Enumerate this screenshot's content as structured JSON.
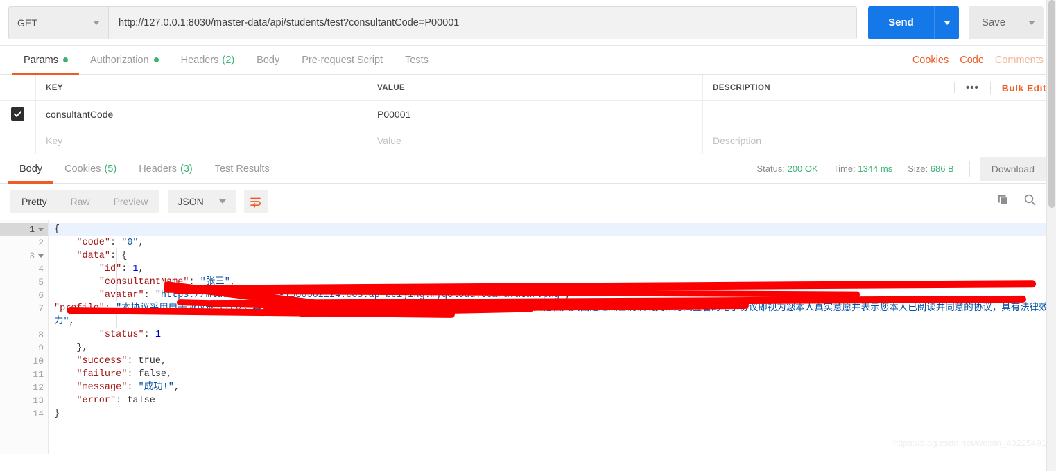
{
  "request": {
    "method": "GET",
    "url": "http://127.0.0.1:8030/master-data/api/students/test?consultantCode=P00001",
    "send_label": "Send",
    "save_label": "Save"
  },
  "request_tabs": [
    {
      "label": "Params",
      "dot": true,
      "count": "",
      "active": true
    },
    {
      "label": "Authorization",
      "dot": true,
      "count": "",
      "active": false
    },
    {
      "label": "Headers",
      "dot": false,
      "count": "(2)",
      "active": false
    },
    {
      "label": "Body",
      "dot": false,
      "count": "",
      "active": false
    },
    {
      "label": "Pre-request Script",
      "dot": false,
      "count": "",
      "active": false
    },
    {
      "label": "Tests",
      "dot": false,
      "count": "",
      "active": false
    }
  ],
  "request_links": [
    {
      "label": "Cookies",
      "muted": false
    },
    {
      "label": "Code",
      "muted": false
    },
    {
      "label": "Comments",
      "muted": true
    }
  ],
  "params": {
    "headers": {
      "key": "KEY",
      "value": "VALUE",
      "description": "DESCRIPTION"
    },
    "bulk_edit_label": "Bulk Edit",
    "dots_label": "•••",
    "rows": [
      {
        "checked": true,
        "key": "consultantCode",
        "value": "P00001",
        "description": "",
        "placeholder": false
      },
      {
        "checked": false,
        "key": "Key",
        "value": "Value",
        "description": "Description",
        "placeholder": true
      }
    ]
  },
  "response_tabs": [
    {
      "label": "Body",
      "count": "",
      "active": true
    },
    {
      "label": "Cookies",
      "count": "(5)",
      "active": false
    },
    {
      "label": "Headers",
      "count": "(3)",
      "active": false
    },
    {
      "label": "Test Results",
      "count": "",
      "active": false
    }
  ],
  "response_meta": {
    "status_label": "Status:",
    "status_value": "200 OK",
    "time_label": "Time:",
    "time_value": "1344 ms",
    "size_label": "Size:",
    "size_value": "686 B",
    "download_label": "Download"
  },
  "body_toolbar": {
    "views": [
      {
        "label": "Pretty",
        "active": true
      },
      {
        "label": "Raw",
        "active": false
      },
      {
        "label": "Preview",
        "active": false
      }
    ],
    "format": "JSON",
    "wrap_icon": "word-wrap-icon",
    "copy_icon": "copy-icon",
    "search_icon": "search-icon"
  },
  "code": {
    "lines": [
      {
        "no": "1",
        "fold": true,
        "current": true,
        "indent": 0,
        "tokens": [
          {
            "t": "{",
            "c": "p"
          }
        ]
      },
      {
        "no": "2",
        "fold": false,
        "current": false,
        "indent": 1,
        "tokens": [
          {
            "t": "\"code\"",
            "c": "k"
          },
          {
            "t": ": ",
            "c": "p"
          },
          {
            "t": "\"0\"",
            "c": "s"
          },
          {
            "t": ",",
            "c": "p"
          }
        ]
      },
      {
        "no": "3",
        "fold": true,
        "current": false,
        "indent": 1,
        "tokens": [
          {
            "t": "\"data\"",
            "c": "k"
          },
          {
            "t": ": {",
            "c": "p"
          }
        ]
      },
      {
        "no": "4",
        "fold": false,
        "current": false,
        "indent": 2,
        "tokens": [
          {
            "t": "\"id\"",
            "c": "k"
          },
          {
            "t": ": ",
            "c": "p"
          },
          {
            "t": "1",
            "c": "n"
          },
          {
            "t": ",",
            "c": "p"
          }
        ]
      },
      {
        "no": "5",
        "fold": false,
        "current": false,
        "indent": 2,
        "tokens": [
          {
            "t": "\"consultantName\"",
            "c": "k"
          },
          {
            "t": ": ",
            "c": "p"
          },
          {
            "t": "\"张三\"",
            "c": "s"
          },
          {
            "t": ",",
            "c": "p"
          }
        ]
      },
      {
        "no": "6",
        "fold": false,
        "current": false,
        "indent": 2,
        "tokens": [
          {
            "t": "\"avatar\"",
            "c": "k"
          },
          {
            "t": ": ",
            "c": "p"
          },
          {
            "t": "\"https://mludulend-1tc-1500562124.cos.ap-beijing.myqcloud.com/avatar.png\"",
            "c": "s"
          },
          {
            "t": ",",
            "c": "p"
          }
        ]
      },
      {
        "no": "7",
        "fold": false,
        "current": false,
        "indent": 2,
        "wrap": true,
        "tokens": [
          {
            "t": "\"profile\"",
            "c": "k"
          },
          {
            "t": ": ",
            "c": "p"
          },
          {
            "t": "\"本协议采用电子协议形式订立，具有法律效力，您在本平台的相关或对，在您浏览本平台注册页面或其他相关页面通过点击确认或类似方式签署的电子协议即视为您本人真实意愿并表示您本人已阅读并同意的协议，具有法律效力\"",
            "c": "s"
          },
          {
            "t": ",",
            "c": "p"
          }
        ]
      },
      {
        "no": "8",
        "fold": false,
        "current": false,
        "indent": 2,
        "tokens": [
          {
            "t": "\"status\"",
            "c": "k"
          },
          {
            "t": ": ",
            "c": "p"
          },
          {
            "t": "1",
            "c": "n"
          }
        ]
      },
      {
        "no": "9",
        "fold": false,
        "current": false,
        "indent": 1,
        "tokens": [
          {
            "t": "},",
            "c": "p"
          }
        ]
      },
      {
        "no": "10",
        "fold": false,
        "current": false,
        "indent": 1,
        "tokens": [
          {
            "t": "\"success\"",
            "c": "k"
          },
          {
            "t": ": ",
            "c": "p"
          },
          {
            "t": "true",
            "c": "b"
          },
          {
            "t": ",",
            "c": "p"
          }
        ]
      },
      {
        "no": "11",
        "fold": false,
        "current": false,
        "indent": 1,
        "tokens": [
          {
            "t": "\"failure\"",
            "c": "k"
          },
          {
            "t": ": ",
            "c": "p"
          },
          {
            "t": "false",
            "c": "b"
          },
          {
            "t": ",",
            "c": "p"
          }
        ]
      },
      {
        "no": "12",
        "fold": false,
        "current": false,
        "indent": 1,
        "tokens": [
          {
            "t": "\"message\"",
            "c": "k"
          },
          {
            "t": ": ",
            "c": "p"
          },
          {
            "t": "\"成功!\"",
            "c": "s"
          },
          {
            "t": ",",
            "c": "p"
          }
        ]
      },
      {
        "no": "13",
        "fold": false,
        "current": false,
        "indent": 1,
        "tokens": [
          {
            "t": "\"error\"",
            "c": "k"
          },
          {
            "t": ": ",
            "c": "p"
          },
          {
            "t": "false",
            "c": "b"
          }
        ]
      },
      {
        "no": "14",
        "fold": false,
        "current": false,
        "indent": 0,
        "tokens": [
          {
            "t": "}",
            "c": "p"
          }
        ]
      }
    ]
  },
  "watermark": "https://blog.csdn.net/weixin_43225491",
  "colors": {
    "accent": "#ef5b25",
    "send": "#1478e8",
    "green": "#3bb273",
    "redaction": "#fb0000"
  }
}
